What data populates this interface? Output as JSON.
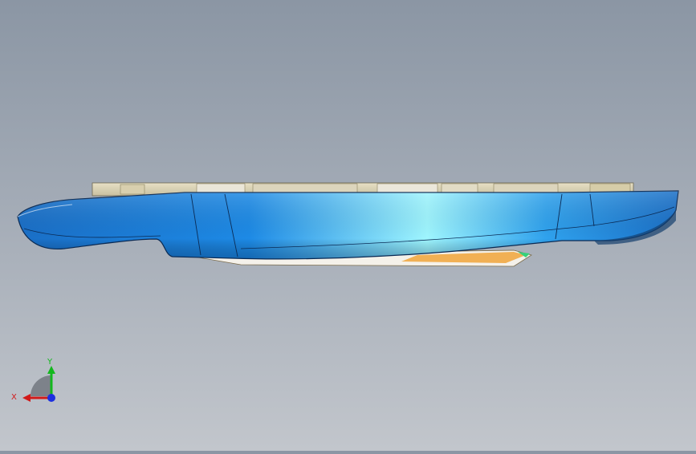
{
  "viewport": {
    "background_top": "#8b96a4",
    "background_bottom": "#c2c6cc",
    "model": {
      "body_color": "#1f7fd6",
      "highlight_color": "#9ff6ff",
      "top_plate_color": "#d9d2b4",
      "bottom_part_color": "#f0a53a"
    }
  },
  "triad": {
    "x_label": "X",
    "y_label": "Y",
    "x_color": "#d11a1a",
    "y_color": "#12b81d",
    "z_color": "#1c2fe0"
  }
}
